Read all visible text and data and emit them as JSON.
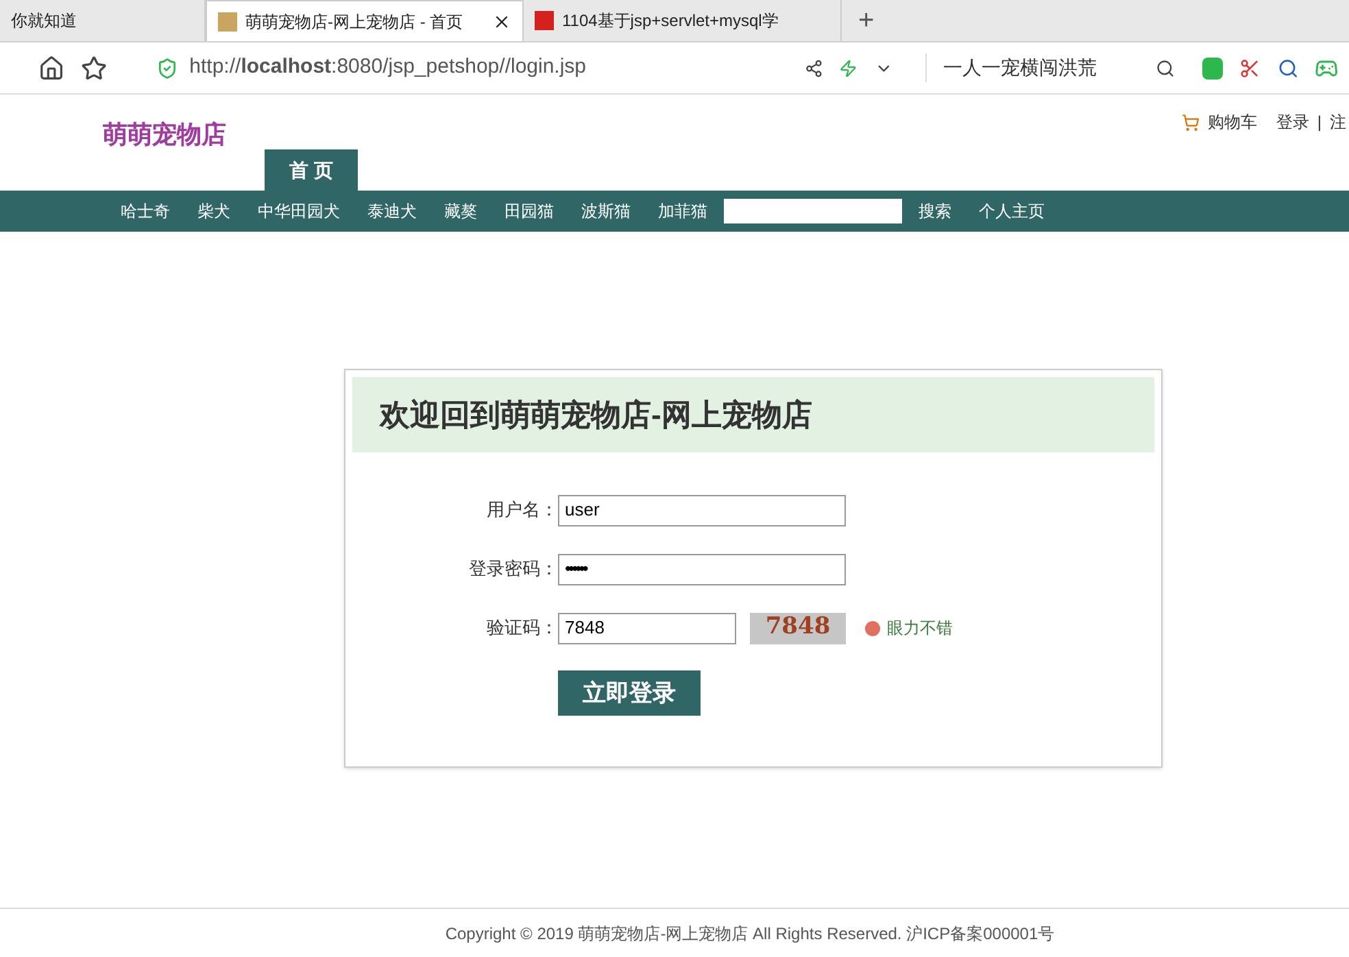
{
  "browser": {
    "tabs": [
      {
        "title": "你就知道",
        "selected": false
      },
      {
        "title": "萌萌宠物店-网上宠物店 - 首页",
        "selected": true
      },
      {
        "title": "1104基于jsp+servlet+mysql学",
        "selected": false
      }
    ],
    "new_tab": "+",
    "url": "http://**localhost**:8080/jsp_petshop//login.jsp",
    "search_text": "一人一宠横闯洪荒"
  },
  "header": {
    "logo": "萌萌宠物店",
    "cart": "购物车",
    "login": "登录",
    "separator": "|",
    "register": "注"
  },
  "home_tab": "首 页",
  "nav": {
    "items": [
      "哈士奇",
      "柴犬",
      "中华田园犬",
      "泰迪犬",
      "藏獒",
      "田园猫",
      "波斯猫",
      "加菲猫"
    ],
    "search_button": "搜索",
    "profile": "个人主页"
  },
  "login": {
    "title": "欢迎回到萌萌宠物店-网上宠物店",
    "fields": [
      {
        "label": "用户名：",
        "value": "user",
        "kind": "text"
      },
      {
        "label": "登录密码：",
        "value": "••••••",
        "kind": "password"
      },
      {
        "label": "验证码：",
        "value": "7848",
        "kind": "captcha"
      }
    ],
    "captcha_text": "7848",
    "captcha_hint": "眼力不错",
    "submit": "立即登录"
  },
  "footer": "Copyright © 2019 萌萌宠物店-网上宠物店 All Rights Reserved. 沪ICP备案000001号"
}
